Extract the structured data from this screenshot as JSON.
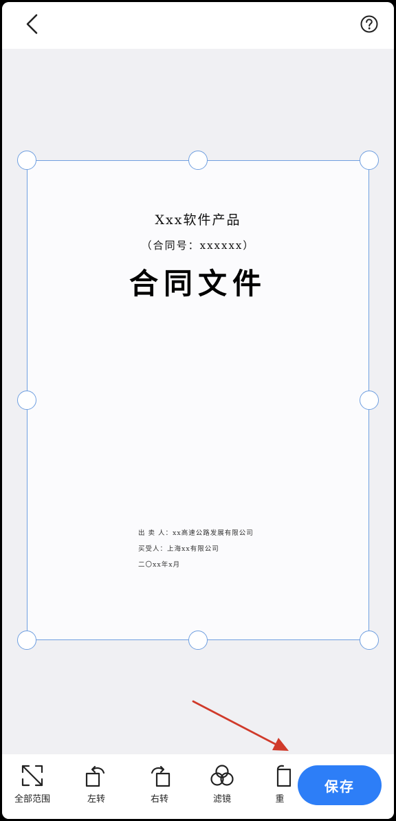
{
  "document": {
    "title": "Xxx软件产品",
    "contract_no": "（合同号：xxxxxx）",
    "heading": "合同文件",
    "meta_lines": [
      "出 卖 人：xx高速公路发展有限公司",
      "买受人：上海xx有限公司",
      "二〇xx年x月"
    ]
  },
  "toolbar": {
    "items": [
      {
        "label": "全部范围",
        "icon": "expand-corners-icon"
      },
      {
        "label": "左转",
        "icon": "rotate-left-icon"
      },
      {
        "label": "右转",
        "icon": "rotate-right-icon"
      },
      {
        "label": "滤镜",
        "icon": "filter-icon"
      },
      {
        "label": "重",
        "icon": "reshoot-icon"
      }
    ],
    "save_label": "保存"
  },
  "colors": {
    "accent": "#2d7ef7",
    "crop_frame": "#6f9fe0",
    "annotation_arrow": "#d03a2a"
  }
}
